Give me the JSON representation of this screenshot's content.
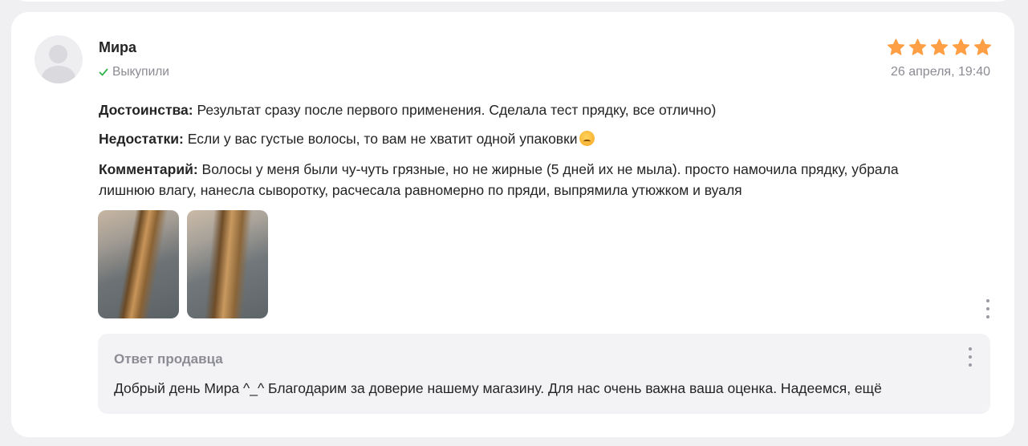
{
  "review": {
    "author": "Мира",
    "verified_label": "Выкупили",
    "rating": 5,
    "max_rating": 5,
    "star_color": "#ff9f45",
    "date": "26 апреля, 19:40",
    "pros_label": "Достоинства:",
    "pros_text": " Результат сразу после первого применения. Сделала тест прядку, все отлично)",
    "cons_label": "Недостатки:",
    "cons_text": " Если у вас густые волосы, то вам не хватит одной упаковки",
    "comment_label": "Комментарий:",
    "comment_text": " Волосы у меня были чу-чуть грязные, но не жирные (5 дней их не мыла). просто намочила прядку, убрала лишнюю влагу, нанесла сыворотку, расчесала равномерно по пряди, выпрямила утюжком и вуаля",
    "photos": [
      "photo-hair-1",
      "photo-hair-2"
    ]
  },
  "reply": {
    "title": "Ответ продавца",
    "text": "Добрый день Мира ^_^ Благодарим за доверие нашему магазину. Для нас очень важна ваша оценка. Надеемся, ещё"
  },
  "icons": {
    "verified": "check-icon",
    "star": "star-icon",
    "menu": "more-vertical-icon",
    "emoji": "sweat-emoji-icon"
  }
}
